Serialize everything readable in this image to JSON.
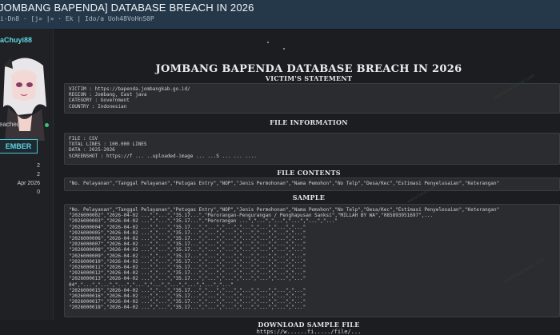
{
  "topbar": {
    "title": "JOMBANG BAPENDA] DATABASE BREACH IN 2026",
    "subtitle": "i-Dn8 · [j» |» · Ek | Ido/a Uoh48VoHnS0P"
  },
  "sidebar": {
    "username": "aChuyi88",
    "status": "eached",
    "badge": "EMBER",
    "stats": [
      "2",
      "2",
      "Apr 2026",
      "0"
    ]
  },
  "main": {
    "title": "JOMBANG BAPENDA DATABASE BREACH IN 2026",
    "victim_heading": "VICTIM'S STATEMENT",
    "victim_lines": [
      "VICTIM : https://bapenda.jombangkab.go.id/",
      "REGION : Jombang, East java",
      "CATEGORY : Government",
      "COUNTRY : Indonesian"
    ],
    "fileinfo_heading": "FILE INFORMATION",
    "fileinfo_lines": [
      "FILE : CSV",
      "TOTAL LINES : 100.000 LINES",
      "DATA : 2025-2026",
      "SCREENSHOT : https://f ... ..uploaded-image ... ...S ... ... ...."
    ],
    "contents_heading": "FILE CONTENTS",
    "contents_line": "\"No. Pelayanan\",\"Tanggal Pelayanan\",\"Petugas Entry\",\"NOP\",\"Jenis Permohonan\",\"Nama Pemohon\",\"No Telp\",\"Desa/Kec\",\"Estimasi Penyelesaian\",\"Keterangan\"",
    "sample_heading": "SAMPLE",
    "sample_lines": [
      "\"No. Pelayanan\",\"Tanggal Pelayanan\",\"Petugas Entry\",\"NOP\",\"Jenis Permohonan\",\"Nama Pemohon\",\"No Telp\",\"Desa/Kec\",\"Estimasi Penyelesaian\",\"Keterangan\"",
      "\"2026000002\",\"2026-04-02 ...\",\"...\",\"35.17...\",\"Perorangan-Pengurangan / Penghapusan Sanksi\",\"MILLAH BY WA\",\"085893951697\",...",
      "\"2026000003\",\"2026-04-02 ...\",\"...\",\"35.17...\",\"Perorangan ...\",\"...\",\"...\",\"...\",\"...\",\"...\"",
      "\"2026000004\",\"2026-04-02 ...\",\"...\",\"35.17...\",\"...\",\"...\",\"...\",\"...\",\"...\",\"...\"",
      "\"2026000005\",\"2026-04-02 ...\",\"...\",\"35.17...\",\"...\",\"...\",\"...\",\"...\",\"...\",\"...\"",
      "\"2026000006\",\"2026-04-02 ...\",\"...\",\"35.17...\",\"...\",\"...\",\"...\",\"...\",\"...\",\"...\"",
      "\"2026000007\",\"2026-04-02 ...\",\"...\",\"35.17...\",\"...\",\"...\",\"...\",\"...\",\"...\",\"...\"",
      "\"2026000008\",\"2026-04-02 ...\",\"...\",\"35.17...\",\"...\",\"...\",\"...\",\"...\",\"...\",\"...\"",
      "\"2026000009\",\"2026-04-02 ...\",\"...\",\"35.17...\",\"...\",\"...\",\"...\",\"...\",\"...\",\"...\"",
      "\"2026000010\",\"2026-04-02 ...\",\"...\",\"35.17...\",\"...\",\"...\",\"...\",\"...\",\"...\",\"...\"",
      "\"2026000011\",\"2026-04-02 ...\",\"...\",\"35.17...\",\"...\",\"...\",\"...\",\"...\",\"...\",\"...\"",
      "\"2026000012\",\"2026-04-02 ...\",\"...\",\"35.17...\",\"...\",\"...\",\"...\",\"...\",\"...\",\"...\"",
      "\"2026000013\",\"2026-04-02 ...\",\"...\",\"35.17...\",\"...\",\"...\",\"...\",\"...\",\"...\",\"...\"",
      "04\",\"...\",\"...\",\"...\",\"...\",\"...\",\"...\",\"...\",\"...\",\"...\"",
      "\"2026000015\",\"2026-04-02 ...\",\"...\",\"35.17...\",\"...\",\"...\",\"...\",\"...\",\"...\",\"...\"",
      "\"2026000016\",\"2026-04-02 ...\",\"...\",\"35.17...\",\"...\",\"...\",\"...\",\"...\",\"...\",\"...\"",
      "\"2026000017\",\"2026-04-02 ...\",\"...\",\"35.17...\",\"...\",\"...\",\"...\",\"...\",\"...\",\"...\"",
      "\"2026000018\",\"2026-04-02 ...\",\"...\",\"35.17...\",\"...\",\"...\",\"...\",\"...\",\"...\",\"...\""
    ],
    "download_heading": "DOWNLOAD SAMPLE FILE",
    "download_link": "https://w......fi...../file/...",
    "watermark": "www.hackmanac.com"
  }
}
